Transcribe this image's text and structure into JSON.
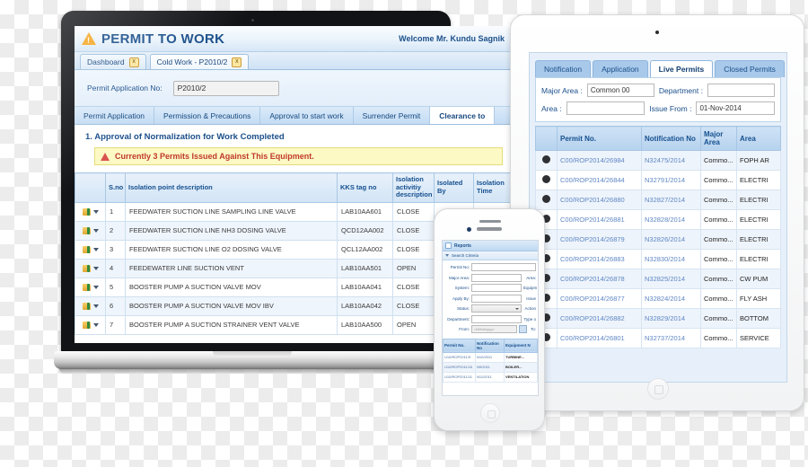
{
  "laptop": {
    "app": {
      "title": "PERMIT TO WORK",
      "welcome": "Welcome Mr. Kundu Sagnik",
      "warning_icon": "warning-triangle-icon",
      "window_tabs": [
        {
          "label": "Dashboard",
          "close": "x"
        },
        {
          "label": "Cold Work - P2010/2",
          "close": "x"
        }
      ],
      "form": {
        "permit_app_no_label": "Permit Application No:",
        "permit_app_no_value": "P2010/2"
      },
      "nav_tabs": [
        {
          "label": "Permit Application"
        },
        {
          "label": "Permission & Precautions"
        },
        {
          "label": "Approval to start work"
        },
        {
          "label": "Surrender Permit"
        },
        {
          "label": "Clearance to"
        }
      ],
      "section_title": "1. Approval of Normalization for Work Completed",
      "alert_text": "Currently 3 Permits Issued Against This Equipment.",
      "table": {
        "columns": [
          "",
          "S.no",
          "Isolation point description",
          "KKS tag no",
          "Isolation activitiy description",
          "Isolated By",
          "Isolation Time"
        ],
        "rows": [
          {
            "sno": "1",
            "desc": "FEEDWATER SUCTION LINE SAMPLING LINE VALVE",
            "kks": "LAB10AA601",
            "act": "CLOSE",
            "by": "",
            "time": ""
          },
          {
            "sno": "2",
            "desc": "FEEDWATER SUCTION LINE NH3 DOSING VALVE",
            "kks": "QCD12AA002",
            "act": "CLOSE",
            "by": "",
            "time": ""
          },
          {
            "sno": "3",
            "desc": "FEEDWATER SUCTION LINE O2 DOSING VALVE",
            "kks": "QCL12AA002",
            "act": "CLOSE",
            "by": "",
            "time": ""
          },
          {
            "sno": "4",
            "desc": "FEEDEWATER LINE SUCTION VENT",
            "kks": "LAB10AA501",
            "act": "OPEN",
            "by": "",
            "time": ""
          },
          {
            "sno": "5",
            "desc": "BOOSTER PUMP A SUCTION VALVE MOV",
            "kks": "LAB10AA041",
            "act": "CLOSE",
            "by": "",
            "time": ""
          },
          {
            "sno": "6",
            "desc": "BOOSTER PUMP A SUCTION VALVE MOV IBV",
            "kks": "LAB10AA042",
            "act": "CLOSE",
            "by": "",
            "time": ""
          },
          {
            "sno": "7",
            "desc": "BOOSTER PUMP A SUCTION STRAINER VENT VALVE",
            "kks": "LAB10AA500",
            "act": "OPEN",
            "by": "",
            "time": ""
          }
        ]
      }
    }
  },
  "tablet": {
    "tabs": [
      {
        "label": "Notification"
      },
      {
        "label": "Application"
      },
      {
        "label": "Live Permits"
      },
      {
        "label": "Closed Permits"
      }
    ],
    "filters": [
      {
        "label": "Major Area :",
        "value": "Common 00"
      },
      {
        "label": "Department :",
        "value": ""
      },
      {
        "label": "Area :",
        "value": ""
      },
      {
        "label": "Issue From :",
        "value": "01-Nov-2014"
      }
    ],
    "table": {
      "columns": [
        "",
        "Permit No.",
        "Notification No",
        "Major Area",
        "Area"
      ],
      "rows": [
        {
          "permit": "C00/ROP2014/26984",
          "notif": "N32475/2014",
          "major": "Commo...",
          "area": "FOPH AR"
        },
        {
          "permit": "C00/ROP2014/26844",
          "notif": "N32791/2014",
          "major": "Commo...",
          "area": "ELECTRI"
        },
        {
          "permit": "C00/ROP2014/26880",
          "notif": "N32827/2014",
          "major": "Commo...",
          "area": "ELECTRI"
        },
        {
          "permit": "C00/ROP2014/26881",
          "notif": "N32828/2014",
          "major": "Commo...",
          "area": "ELECTRI"
        },
        {
          "permit": "C00/ROP2014/26879",
          "notif": "N32826/2014",
          "major": "Commo...",
          "area": "ELECTRI"
        },
        {
          "permit": "C00/ROP2014/26883",
          "notif": "N32830/2014",
          "major": "Commo...",
          "area": "ELECTRI"
        },
        {
          "permit": "C00/ROP2014/26878",
          "notif": "N32825/2014",
          "major": "Commo...",
          "area": "CW PUM"
        },
        {
          "permit": "C00/ROP2014/26877",
          "notif": "N32824/2014",
          "major": "Commo...",
          "area": "FLY ASH"
        },
        {
          "permit": "C00/ROP2014/26882",
          "notif": "N32829/2014",
          "major": "Commo...",
          "area": "BOTTOM"
        },
        {
          "permit": "C00/ROP2014/26801",
          "notif": "N32737/2014",
          "major": "Commo...",
          "area": "SERVICE"
        }
      ]
    }
  },
  "phone": {
    "window_title": "Reports",
    "search_title": "Search Criteria",
    "fields": [
      {
        "label": "Permit No:",
        "value": ""
      },
      {
        "label": "Major Area:",
        "value": ""
      },
      {
        "label": "Area:",
        "value": ""
      },
      {
        "label": "System:",
        "value": ""
      },
      {
        "label": "Equipm",
        "value": ""
      },
      {
        "label": "Apply By:",
        "value": ""
      },
      {
        "label": "Issue",
        "value": ""
      },
      {
        "label": "Status:",
        "value": ""
      },
      {
        "label": "Action",
        "value": ""
      },
      {
        "label": "Department:",
        "value": ""
      },
      {
        "label": "Type o",
        "value": ""
      },
      {
        "label": "From:",
        "value": "<MM/dd/yyyy>"
      },
      {
        "label": "To:",
        "value": "<MM"
      }
    ],
    "table": {
      "columns": [
        "Permit No.",
        "Notification No",
        "Equipment N"
      ],
      "rows": [
        {
          "permit": "U10/ROP2011/9",
          "notif": "N10/2011",
          "equip": "TURBINE..."
        },
        {
          "permit": "U10/ROP2011/10",
          "notif": "N9/2011",
          "equip": "BOILER..."
        },
        {
          "permit": "U10/ROP2011/11",
          "notif": "N11/2011",
          "equip": "VENTILATION"
        }
      ]
    }
  }
}
